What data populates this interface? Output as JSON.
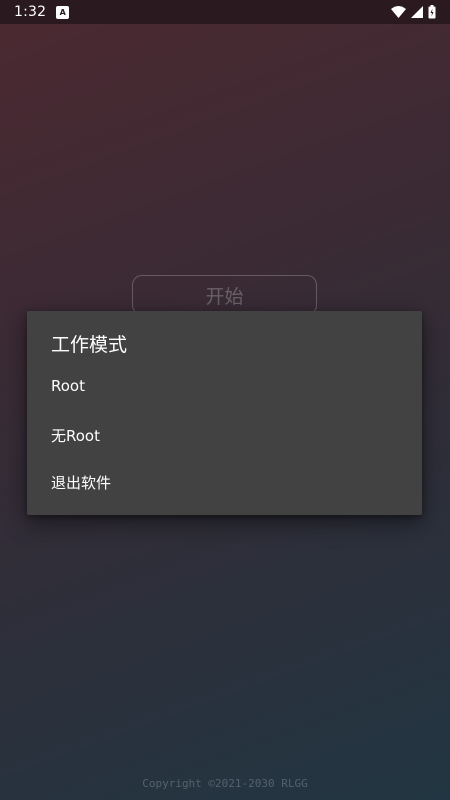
{
  "status_bar": {
    "time": "1:32",
    "notification_icon": "A",
    "icons": [
      "wifi-icon",
      "signal-icon",
      "battery-icon"
    ]
  },
  "main": {
    "start_label": "开始"
  },
  "dialog": {
    "title": "工作模式",
    "items": [
      {
        "label": "Root"
      },
      {
        "label": "无Root"
      },
      {
        "label": "退出软件"
      }
    ]
  },
  "footer": {
    "copyright": "Copyright ©2021-2030 RLGG"
  },
  "colors": {
    "dialog_bg": "#424242",
    "status_bar_bg": "#2a1a1f",
    "gradient_top": "#6a3a45",
    "gradient_bottom": "#2f4b5c"
  }
}
